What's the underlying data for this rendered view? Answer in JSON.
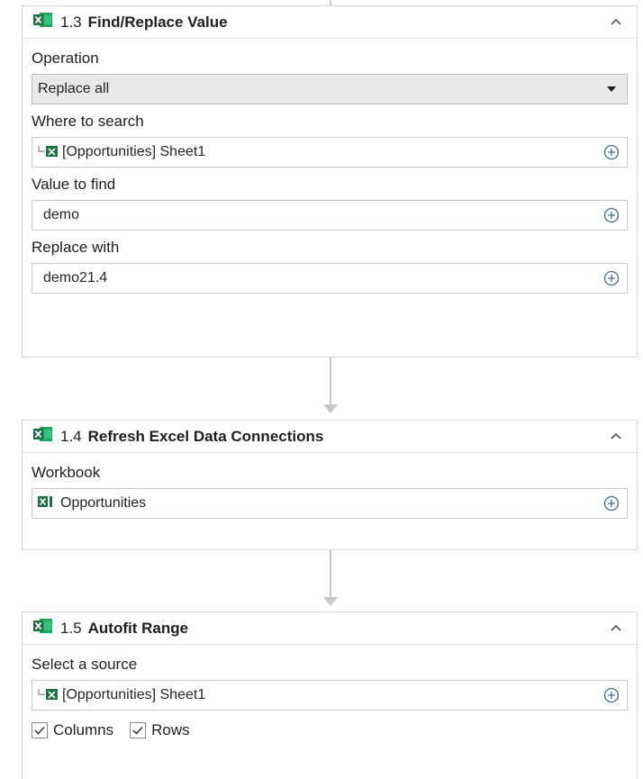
{
  "colors": {
    "excel_green": "#1e7145",
    "excel_green_light": "#21a366",
    "connector": "#c8c8c8",
    "plus_icon": "#4b6a8a"
  },
  "cards": [
    {
      "step": "1.3",
      "title": "Find/Replace Value",
      "fields": {
        "operation_label": "Operation",
        "operation_value": "Replace all",
        "where_label": "Where to search",
        "where_value": "[Opportunities] Sheet1",
        "find_label": "Value to find",
        "find_value": "demo",
        "replace_label": "Replace with",
        "replace_value": "demo21.4"
      }
    },
    {
      "step": "1.4",
      "title": "Refresh Excel Data Connections",
      "fields": {
        "workbook_label": "Workbook",
        "workbook_value": "Opportunities"
      }
    },
    {
      "step": "1.5",
      "title": "Autofit Range",
      "fields": {
        "source_label": "Select a source",
        "source_value": "[Opportunities] Sheet1",
        "columns_label": "Columns",
        "columns_checked": true,
        "rows_label": "Rows",
        "rows_checked": true
      }
    }
  ],
  "icons": {
    "action_icon": "excel-icon",
    "sheet_icon": "excel-sheet-icon",
    "workbook_icon": "excel-workbook-icon",
    "collapse_icon": "chevron-up-icon",
    "add_icon": "plus-circle-icon",
    "dropdown_icon": "caret-down-icon",
    "check_icon": "checkmark-icon"
  }
}
